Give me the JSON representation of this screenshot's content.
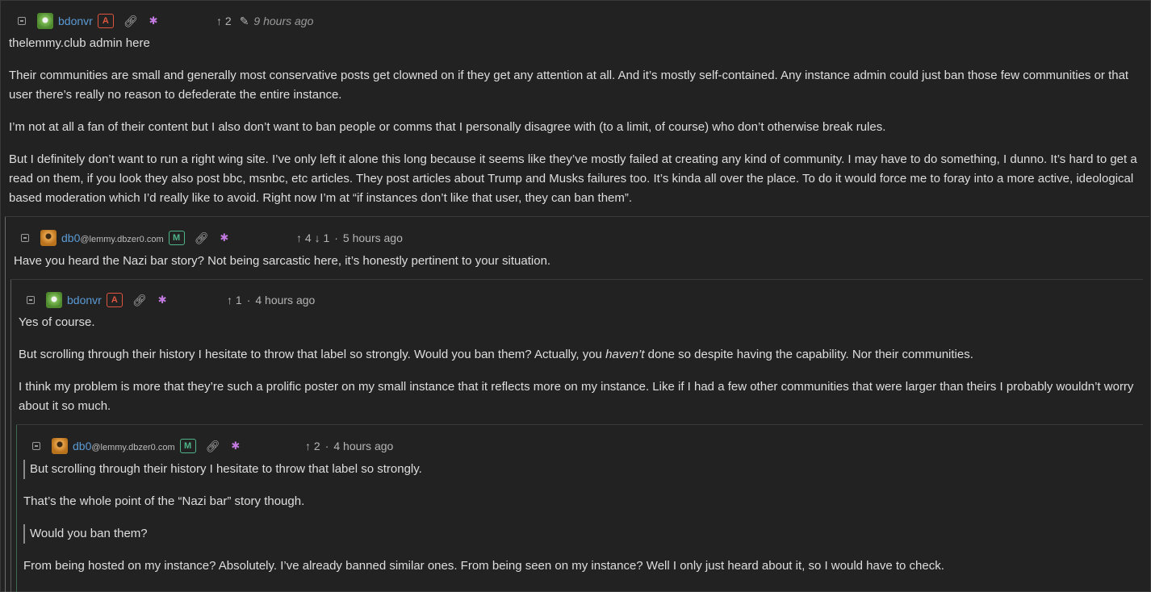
{
  "comments": [
    {
      "username": "bdonvr",
      "instance": "",
      "badge": "A",
      "score": "↑ 2",
      "time": "9 hours ago",
      "edited": true,
      "paragraphs": [
        "thelemmy.club admin here",
        "Their communities are small and generally most conservative posts get clowned on if they get any attention at all. And it’s mostly self-contained. Any instance admin could just ban those few communities or that user there’s really no reason to defederate the entire instance.",
        "I’m not at all a fan of their content but I also don’t want to ban people or comms that I personally disagree with (to a limit, of course) who don’t otherwise break rules.",
        "But I definitely don’t want to run a right wing site. I’ve only left it alone this long because it seems like they’ve mostly failed at creating any kind of community. I may have to do something, I dunno. It’s hard to get a read on them, if you look they also post bbc, msnbc, etc articles. They post articles about Trump and Musks failures too. It’s kinda all over the place. To do it would force me to foray into a more active, ideological based moderation which I’d really like to avoid. Right now I’m at “if instances don’t like that user, they can ban them”."
      ]
    },
    {
      "username": "db0",
      "instance": "@lemmy.dbzer0.com",
      "badge": "M",
      "score": "↑ 4 ↓ 1",
      "time": "5 hours ago",
      "paragraphs": [
        "Have you heard the Nazi bar story? Not being sarcastic here, it’s honestly pertinent to your situation."
      ]
    },
    {
      "username": "bdonvr",
      "instance": "",
      "badge": "A",
      "score": "↑ 1",
      "time": "4 hours ago",
      "p1": "Yes of course.",
      "p2_before": "But scrolling through their history I hesitate to throw that label so strongly. Would you ban them? Actually, you ",
      "p2_em": "haven’t",
      "p2_after": " done so despite having the capability. Nor their communities.",
      "p3": "I think my problem is more that they’re such a prolific poster on my small instance that it reflects more on my instance. Like if I had a few other communities that were larger than theirs I probably wouldn’t worry about it so much."
    },
    {
      "username": "db0",
      "instance": "@lemmy.dbzer0.com",
      "badge": "M",
      "score": "↑ 2",
      "time": "4 hours ago",
      "quote1": "But scrolling through their history I hesitate to throw that label so strongly.",
      "p1": "That’s the whole point of the “Nazi bar” story though.",
      "quote2": "Would you ban them?",
      "p2": "From being hosted on my instance? Absolutely. I’ve already banned similar ones. From being seen on my instance? Well I only just heard about it, so I would have to check."
    }
  ]
}
